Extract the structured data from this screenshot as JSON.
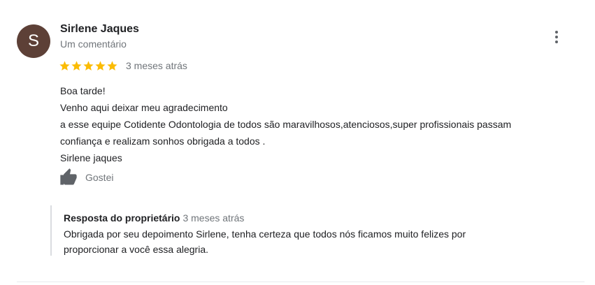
{
  "reviewer": {
    "avatar_letter": "S",
    "avatar_color": "#5d4037",
    "name": "Sirlene Jaques",
    "meta": "Um comentário"
  },
  "menu_icon": "more-vert-icon",
  "review": {
    "rating": 5,
    "rating_max": 5,
    "star_color": "#fbbc04",
    "date": "3 meses atrás",
    "lines": [
      "Boa tarde!",
      "Venho aqui deixar meu agradecimento",
      "a esse equipe Cotidente Odontologia de todos são maravilhosos,atenciosos,super profissionais passam",
      "confiança e realizam sonhos obrigada a todos .",
      "Sirlene jaques"
    ]
  },
  "like": {
    "icon": "thumb-up-icon",
    "label": "Gostei"
  },
  "owner_reply": {
    "title": "Resposta do proprietário",
    "date": "3 meses atrás",
    "lines": [
      "Obrigada por seu depoimento Sirlene, tenha certeza que todos nós ficamos muito felizes por",
      "proporcionar a você essa alegria."
    ]
  }
}
